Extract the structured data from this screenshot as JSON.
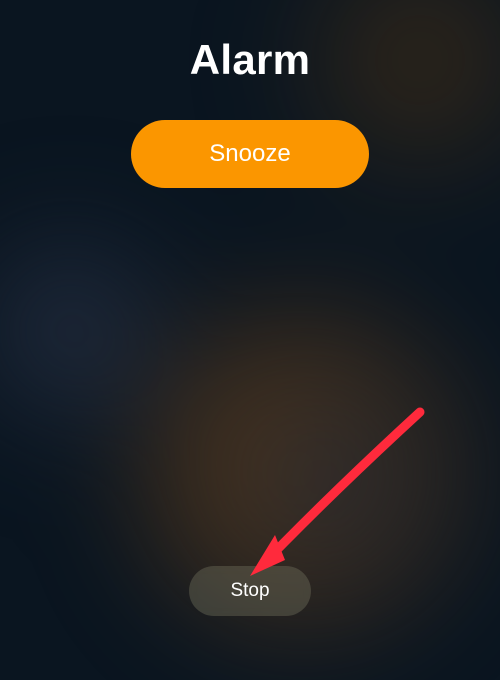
{
  "alarm": {
    "title": "Alarm",
    "snooze_label": "Snooze",
    "stop_label": "Stop"
  },
  "annotation": {
    "arrow_color": "#ff2a3c"
  }
}
